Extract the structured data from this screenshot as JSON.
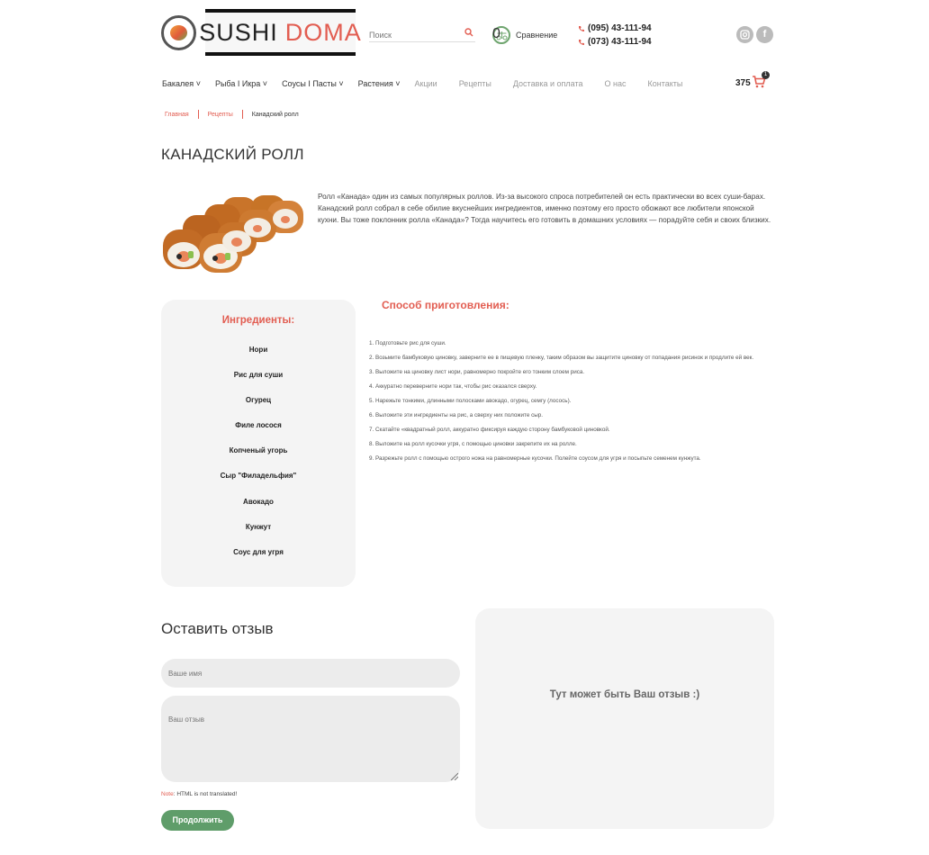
{
  "header": {
    "logo_word1": "SUSHI",
    "logo_word2": "DOMA",
    "search_placeholder": "Поиск",
    "compare_label": "Сравнение",
    "compare_count": "0",
    "phones": [
      "(095) 43-111-94",
      "(073) 43-111-94"
    ],
    "social": [
      "instagram-icon",
      "facebook-icon"
    ]
  },
  "nav": {
    "items": [
      {
        "label": "Бакалея",
        "dropdown": true
      },
      {
        "label": "Рыба I Икра",
        "dropdown": true
      },
      {
        "label": "Соусы I Пасты",
        "dropdown": true
      },
      {
        "label": "Растения",
        "dropdown": true
      },
      {
        "label": "Акции",
        "dropdown": false
      },
      {
        "label": "Рецепты",
        "dropdown": false
      },
      {
        "label": "Доставка и оплата",
        "dropdown": false
      },
      {
        "label": "О нас",
        "dropdown": false
      },
      {
        "label": "Контакты",
        "dropdown": false
      }
    ],
    "cart_total": "375",
    "cart_count": "1"
  },
  "breadcrumb": {
    "home": "Главная",
    "recipes": "Рецепты",
    "current": "Канадский ролл"
  },
  "page": {
    "title": "КАНАДСКИЙ РОЛЛ",
    "intro": "Ролл «Канада» один из самых популярных роллов. Из-за высокого спроса потребителей он есть практически во всех суши-барах. Канадский ролл собрал в себе обилие вкуснейших ингредиентов, именно поэтому его просто обожают все любители японской кухни. Вы тоже поклонник ролла «Канада»? Тогда научитесь его готовить в домашних условиях — порадуйте себя и своих близких."
  },
  "ingredients": {
    "title": "Ингредиенты:",
    "items": [
      "Нори",
      "Рис для суши",
      "Огурец",
      "Филе лосося",
      "Копченый угорь",
      "Сыр \"Филадельфия\"",
      "Авокадо",
      "Кунжут",
      "Соус для угря"
    ]
  },
  "method": {
    "title": "Способ приготовления:",
    "steps": [
      "1. Подготовьте рис для суши.",
      "2. Возьмите бамбуковую циновку, заверните ее в пищевую пленку, таким образом вы защитите циновку от попадания рисинок и продлите ей век.",
      "3. Выложите на циновку лист нори, равномерно покройте его тонким слоем риса.",
      "4. Аккуратно переверните нори так, чтобы рис оказался сверху.",
      "5. Нарежьте тонкими, длинными полосками авокадо, огурец, семгу (лосось).",
      "6. Выложите эти ингредиенты на рис, а сверху них положите сыр.",
      "7. Скатайте «квадратный ролл, аккуратно фиксируя каждую сторону бамбуковой циновкой.",
      "8. Выложите на ролл кусочки угря, с помощью циновки закрепите их на ролле.",
      "9. Разрежьте ролл с помощью острого ножа на равномерные кусочки. Полейте соусом для угря и посыпьте семенем кунжута."
    ]
  },
  "review": {
    "heading": "Оставить отзыв",
    "name_placeholder": "Ваше имя",
    "text_placeholder": "Ваш отзыв",
    "note_label": "Note",
    "note_text": ": HTML is not translated!",
    "submit": "Продолжить",
    "panel_message": "Тут может быть Ваш отзыв :)"
  },
  "colors": {
    "accent": "#e25d51",
    "button": "#5f9d6a",
    "panel": "#f4f4f4"
  }
}
